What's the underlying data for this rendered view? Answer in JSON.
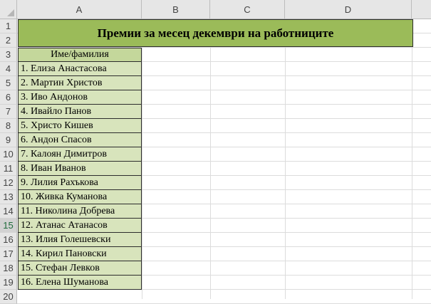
{
  "columns": [
    "A",
    "B",
    "C",
    "D"
  ],
  "rows": [
    "1",
    "2",
    "3",
    "4",
    "5",
    "6",
    "7",
    "8",
    "9",
    "10",
    "11",
    "12",
    "13",
    "14",
    "15",
    "16",
    "17",
    "18",
    "19",
    "20"
  ],
  "active_row": "15",
  "title": "Премии за месец декември на работниците",
  "header": "Име/фамилия",
  "employees": [
    "1. Елиза Анастасова",
    "2. Мартин Христов",
    "3. Иво Андонов",
    "4. Ивайло Панов",
    "5. Христо Кишев",
    "6. Андон Спасов",
    "7. Калоян Димитров",
    "8. Иван Иванов",
    "9. Лилия Рахъкова",
    "10. Живка Куманова",
    "11. Николина Добрева",
    "12. Атанас Атанасов",
    "13. Илия Голешевски",
    "14. Кирил Пановски",
    "15. Стефан Левков",
    "16. Елена Шуманова"
  ],
  "colors": {
    "title_fill": "#9bbb59",
    "header_fill": "#c4d79b",
    "name_fill": "#d8e4bc"
  }
}
